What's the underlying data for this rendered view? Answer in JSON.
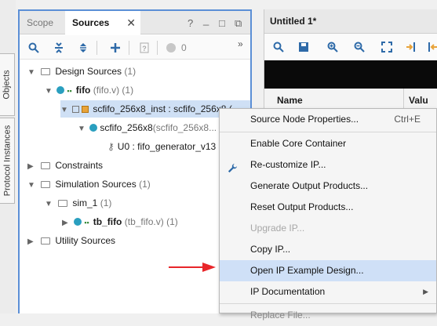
{
  "side_tabs": [
    "Objects",
    "Protocol Instances"
  ],
  "sources_panel": {
    "tabs": [
      "Scope",
      "Sources"
    ],
    "close_glyph": "✕",
    "controls": [
      "?",
      "_",
      "□",
      "⧉"
    ],
    "toolbar_icons": [
      "search-icon",
      "collapse-all-icon",
      "expand-all-icon",
      "add-icon",
      "unknown-file-icon",
      "status-dot-icon"
    ],
    "toolbar_count": "0",
    "overflow": "»",
    "tree": {
      "design_sources": {
        "label": "Design Sources",
        "count": "(1)"
      },
      "fifo": {
        "name": "fifo",
        "file": "(fifo.v)",
        "count": "(1)"
      },
      "ip_inst": {
        "label": "scfifo_256x8_inst : scfifo_256x8 ("
      },
      "scfifo": {
        "name": "scfifo_256x8",
        "file": "(scfifo_256x8..."
      },
      "u0": {
        "label": "U0 : fifo_generator_v13"
      },
      "constraints": {
        "label": "Constraints"
      },
      "sim_sources": {
        "label": "Simulation Sources",
        "count": "(1)"
      },
      "sim_1": {
        "label": "sim_1",
        "count": "(1)"
      },
      "tb_fifo": {
        "name": "tb_fifo",
        "file": "(tb_fifo.v)",
        "count": "(1)"
      },
      "utility_sources": {
        "label": "Utility Sources"
      }
    }
  },
  "right_panel": {
    "title": "Untitled 1*",
    "columns": [
      "Name",
      "Valu"
    ]
  },
  "context_menu": {
    "items": [
      {
        "label": "Source Node Properties...",
        "shortcut": "Ctrl+E"
      },
      {
        "label": "Enable Core Container"
      },
      {
        "label": "Re-customize IP..."
      },
      {
        "label": "Generate Output Products..."
      },
      {
        "label": "Reset Output Products..."
      },
      {
        "label": "Upgrade IP...",
        "disabled": true
      },
      {
        "label": "Copy IP..."
      },
      {
        "label": "Open IP Example Design...",
        "highlighted": true
      },
      {
        "label": "IP Documentation",
        "submenu": true
      },
      {
        "label": "Replace File..."
      }
    ],
    "submenu_arrow": "▶"
  },
  "colors": {
    "panel_border": "#5b8fd6",
    "selection": "#cfe0f5",
    "menu_highlight": "#cfe0f7",
    "annotation_arrow": "#e8262a",
    "toolbar_icon": "#2e6aa8"
  }
}
